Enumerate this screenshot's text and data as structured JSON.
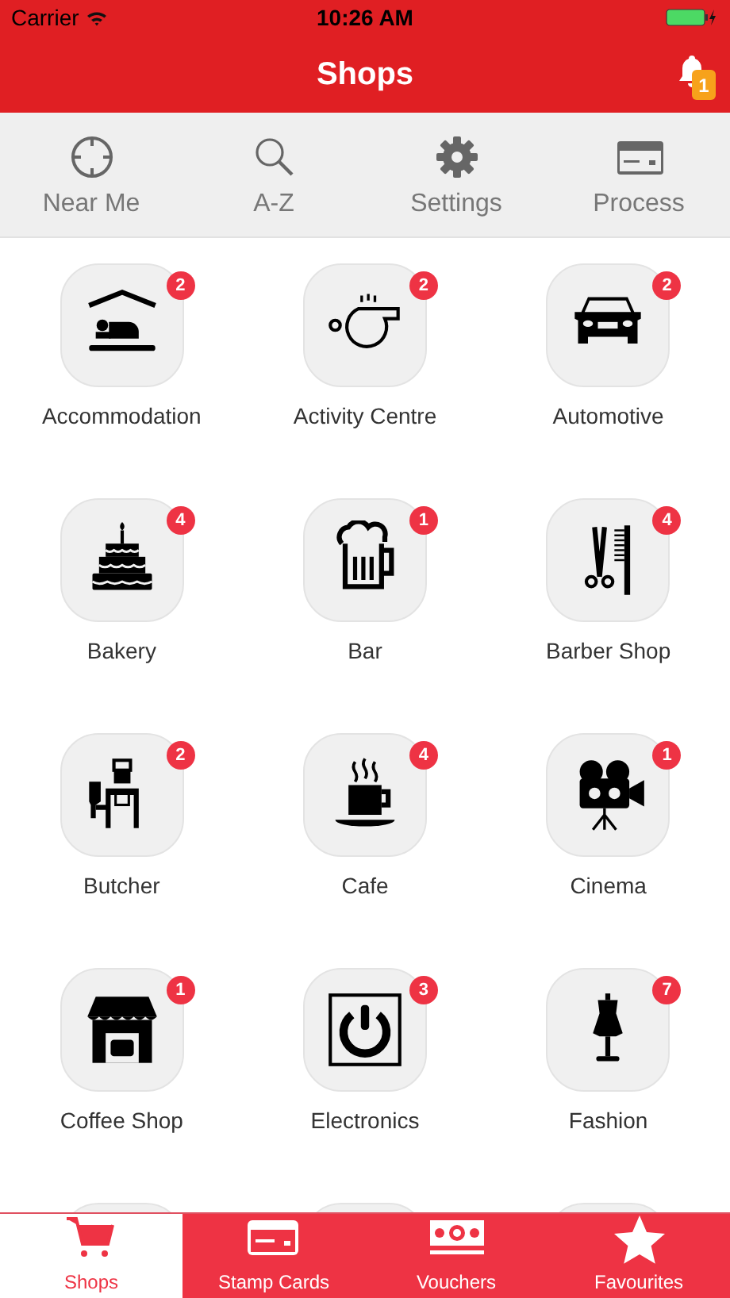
{
  "status_bar": {
    "carrier": "Carrier",
    "time": "10:26 AM"
  },
  "nav_bar": {
    "title": "Shops",
    "notification_count": "1"
  },
  "toolbar": [
    {
      "label": "Near Me"
    },
    {
      "label": "A-Z"
    },
    {
      "label": "Settings"
    },
    {
      "label": "Process"
    }
  ],
  "categories": [
    {
      "kind": "tile",
      "label": "Accommodation",
      "count": "2"
    },
    {
      "kind": "tile",
      "label": "Activity Centre",
      "count": "2"
    },
    {
      "kind": "tile",
      "label": "Automotive",
      "count": "2"
    },
    {
      "kind": "tile",
      "label": "Bakery",
      "count": "4"
    },
    {
      "kind": "tile",
      "label": "Bar",
      "count": "1"
    },
    {
      "kind": "tile",
      "label": "Barber Shop",
      "count": "4"
    },
    {
      "kind": "tile",
      "label": "Butcher",
      "count": "2"
    },
    {
      "kind": "tile",
      "label": "Cafe",
      "count": "4"
    },
    {
      "kind": "tile",
      "label": "Cinema",
      "count": "1"
    },
    {
      "kind": "tile",
      "label": "Coffee Shop",
      "count": "1"
    },
    {
      "kind": "tile",
      "label": "Electronics",
      "count": "3"
    },
    {
      "kind": "tile",
      "label": "Fashion",
      "count": "7"
    },
    {
      "kind": "cut_off"
    },
    {
      "kind": "cut_off"
    },
    {
      "kind": "cut_off"
    }
  ],
  "tab_bar": [
    {
      "label": "Shops",
      "selected": true
    },
    {
      "label": "Stamp Cards",
      "selected": false
    },
    {
      "label": "Vouchers",
      "selected": false
    },
    {
      "label": "Favourites",
      "selected": false
    }
  ]
}
